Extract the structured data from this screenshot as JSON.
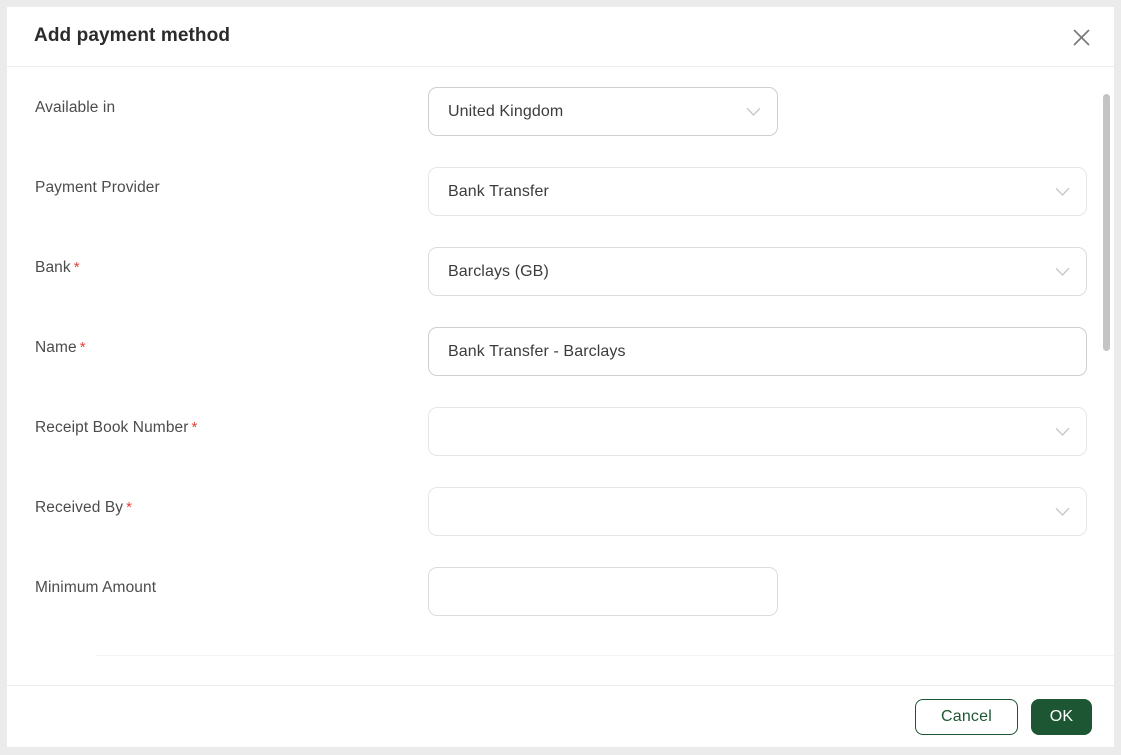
{
  "modal": {
    "title": "Add payment method",
    "close_icon": "close-icon"
  },
  "form": {
    "rows": [
      {
        "label": "Available in",
        "required": false,
        "control": "select",
        "value": "United Kingdom",
        "width": "narrow",
        "border": "strong",
        "icon": "chevron-down-icon"
      },
      {
        "label": "Payment Provider",
        "required": false,
        "control": "select",
        "value": "Bank Transfer",
        "width": "wide",
        "border": "faint",
        "icon": "chevron-down-icon"
      },
      {
        "label": "Bank",
        "required": true,
        "control": "select",
        "value": "Barclays (GB)",
        "width": "wide",
        "border": "normal",
        "icon": "chevron-down-icon"
      },
      {
        "label": "Name",
        "required": true,
        "control": "text",
        "value": "Bank Transfer - Barclays",
        "width": "wide",
        "border": "strong",
        "icon": ""
      },
      {
        "label": "Receipt Book Number",
        "required": true,
        "control": "select",
        "value": "",
        "width": "wide",
        "border": "faint",
        "icon": "chevron-down-icon"
      },
      {
        "label": "Received By",
        "required": true,
        "control": "select",
        "value": "",
        "width": "wide",
        "border": "faint",
        "icon": "chevron-down-icon"
      },
      {
        "label": "Minimum Amount",
        "required": false,
        "control": "text",
        "value": "",
        "width": "narrow",
        "border": "normal",
        "icon": ""
      }
    ],
    "required_marker": "*"
  },
  "footer": {
    "cancel_label": "Cancel",
    "ok_label": "OK"
  },
  "colors": {
    "primary_green": "#1d5632",
    "required_red": "#e8413a",
    "page_background": "#ebebeb",
    "field_border": "#dcdcdc"
  }
}
